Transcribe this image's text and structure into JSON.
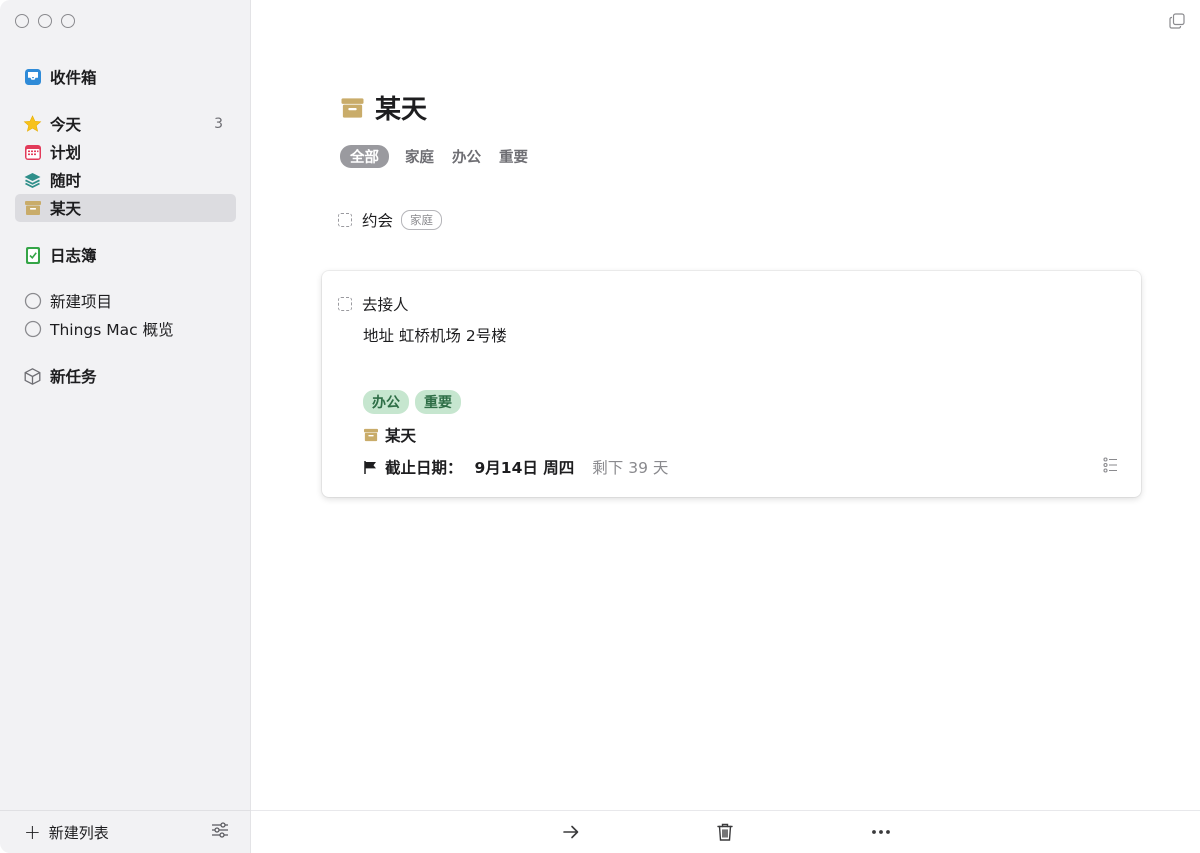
{
  "sidebar": {
    "inbox": "收件箱",
    "today": {
      "label": "今天",
      "count": "3"
    },
    "upcoming": "计划",
    "anytime": "随时",
    "someday": "某天",
    "logbook": "日志簿",
    "projects": [
      "新建项目",
      "Things Mac 概览"
    ],
    "area": "新任务",
    "footer": {
      "new_list": "新建列表"
    }
  },
  "main": {
    "title": "某天",
    "filters": [
      "全部",
      "家庭",
      "办公",
      "重要"
    ],
    "tasks": [
      {
        "title": "约会",
        "tag": "家庭"
      }
    ],
    "expanded_task": {
      "title": "去接人",
      "notes": "地址 虹桥机场 2号楼",
      "tags": [
        "办公",
        "重要"
      ],
      "when": "某天",
      "deadline_label": "截止日期：",
      "deadline_date": "9月14日 周四",
      "remaining": "剩下 39 天"
    }
  },
  "colors": {
    "inbox": "#2f8bd8",
    "today": "#f7c21b",
    "upcoming": "#e23b5a",
    "anytime": "#2f8f8a",
    "someday": "#c9ac6a",
    "logbook": "#35a547",
    "tag_green_bg": "#c6e6cf"
  }
}
